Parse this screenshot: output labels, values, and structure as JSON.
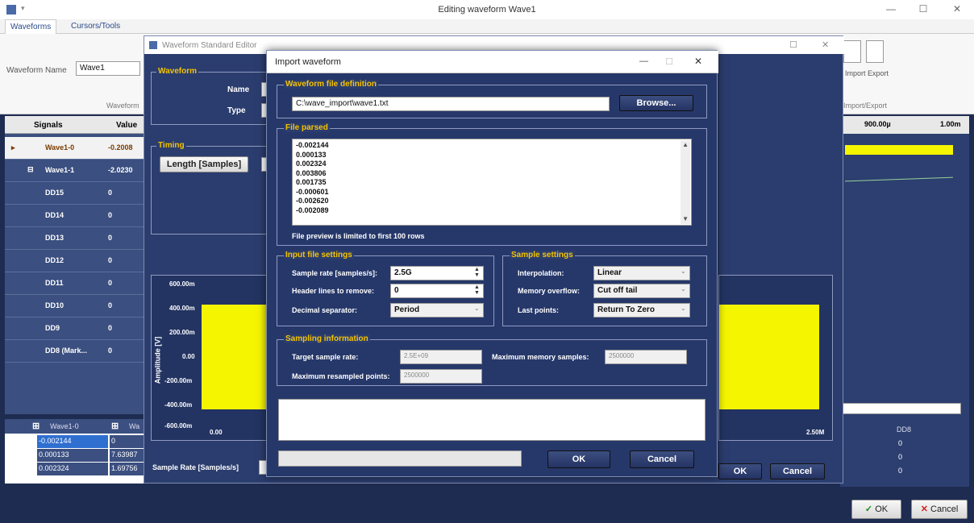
{
  "window": {
    "title": "Editing waveform Wave1",
    "minimize": "—",
    "maximize": "☐",
    "close": "✕"
  },
  "tabs": [
    {
      "label": "Waveforms"
    },
    {
      "label": "Cursors/Tools"
    }
  ],
  "ribbon": {
    "waveform_name_label": "Waveform Name",
    "waveform_name_value": "Wave1",
    "group_left": "Waveform",
    "import_label": "Import",
    "export_label": "Export",
    "group_right": "Import/Export"
  },
  "grid": {
    "col_signals": "Signals",
    "col_value": "Value",
    "rows": [
      {
        "name": "Wave1-0",
        "value": "-0.2008"
      },
      {
        "name": "Wave1-1",
        "value": "-2.0230"
      },
      {
        "name": "DD15",
        "value": "0"
      },
      {
        "name": "DD14",
        "value": "0"
      },
      {
        "name": "DD13",
        "value": "0"
      },
      {
        "name": "DD12",
        "value": "0"
      },
      {
        "name": "DD11",
        "value": "0"
      },
      {
        "name": "DD10",
        "value": "0"
      },
      {
        "name": "DD9",
        "value": "0"
      },
      {
        "name": "DD8 (Mark...",
        "value": "0"
      }
    ]
  },
  "bottom_table": {
    "headers": [
      "Wave1-0",
      "Wa"
    ],
    "rows": [
      [
        "-0.002144",
        "0"
      ],
      [
        "0.000133",
        "7.63987"
      ],
      [
        "0.002324",
        "1.69756"
      ]
    ],
    "right_header": "DD8",
    "right_values": [
      "0",
      "0",
      "0"
    ]
  },
  "timeline": {
    "tick1": "900.00µ",
    "tick2": "1.00m"
  },
  "editor": {
    "title": "Waveform Standard Editor",
    "waveform_group": "Waveform",
    "name_label": "Name",
    "type_label": "Type",
    "timing_group": "Timing",
    "length_label": "Length [Samples]",
    "sample_rate_label": "Sample Rate [Samples/s]",
    "y_axis_label": "Amplitude [V]",
    "y_ticks": [
      "600.00m",
      "400.00m",
      "200.00m",
      "0.00",
      "-200.00m",
      "-400.00m",
      "-600.00m"
    ],
    "x_tick_left": "0.00",
    "x_tick_right": "2.50M",
    "ok": "OK",
    "cancel": "Cancel"
  },
  "dialog": {
    "title": "Import waveform",
    "file_def_group": "Waveform file definition",
    "file_path": "C:\\wave_import\\wave1.txt",
    "browse": "Browse...",
    "file_parsed_group": "File parsed",
    "parsed_lines": [
      "-0.002144",
      "0.000133",
      "0.002324",
      "0.003806",
      "0.001735",
      "-0.000601",
      "-0.002620",
      "-0.002089"
    ],
    "preview_note": "File preview is limited to first 100 rows",
    "input_group": "Input file settings",
    "sample_rate_label": "Sample rate [samples/s]:",
    "sample_rate_value": "2.5G",
    "header_lines_label": "Header lines to remove:",
    "header_lines_value": "0",
    "decimal_label": "Decimal separator:",
    "decimal_value": "Period",
    "sample_group": "Sample settings",
    "interp_label": "Interpolation:",
    "interp_value": "Linear",
    "overflow_label": "Memory overflow:",
    "overflow_value": "Cut off tail",
    "last_label": "Last points:",
    "last_value": "Return To Zero",
    "sampling_group": "Sampling information",
    "target_label": "Target sample rate:",
    "target_value": "2.5E+09",
    "max_mem_label": "Maximum memory samples:",
    "max_mem_value": "2500000",
    "max_resampled_label": "Maximum resampled points:",
    "max_resampled_value": "2500000",
    "ok": "OK",
    "cancel": "Cancel"
  },
  "footer": {
    "ok": "OK",
    "cancel": "Cancel"
  }
}
